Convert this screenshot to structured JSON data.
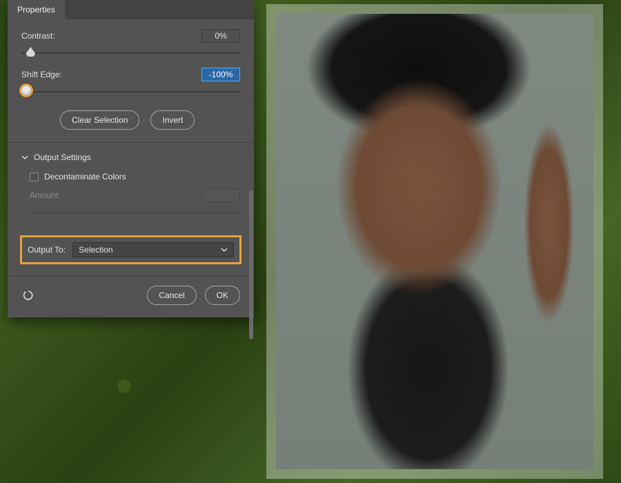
{
  "panel": {
    "tab": "Properties",
    "contrast": {
      "label": "Contrast:",
      "value": "0%",
      "pos": 2
    },
    "shiftEdge": {
      "label": "Shift Edge:",
      "value": "-100%",
      "pos": 0
    },
    "buttons": {
      "clear": "Clear Selection",
      "invert": "Invert"
    },
    "output": {
      "sectionTitle": "Output Settings",
      "decontaminate": {
        "label": "Decontaminate Colors",
        "checked": false
      },
      "amount": {
        "label": "Amount:",
        "value": ""
      },
      "outputTo": {
        "label": "Output To:",
        "value": "Selection"
      }
    },
    "footer": {
      "cancel": "Cancel",
      "ok": "OK"
    }
  }
}
